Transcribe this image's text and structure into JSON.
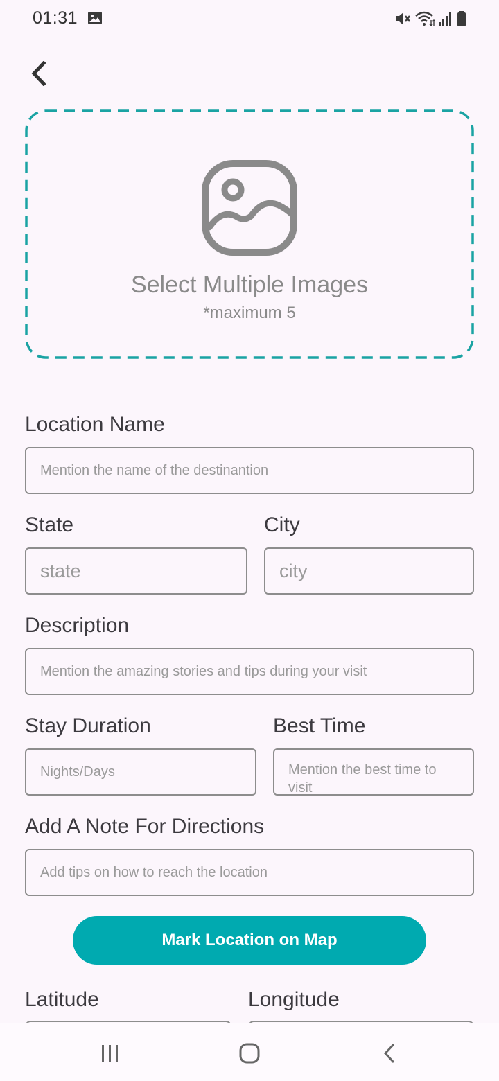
{
  "status_bar": {
    "time": "01:31",
    "icons": [
      "gallery-icon",
      "mute-icon",
      "wifi-icon",
      "signal-icon",
      "battery-icon"
    ]
  },
  "navigation": {
    "back_icon": "chevron-left-icon"
  },
  "image_picker": {
    "icon": "image-icon",
    "title": "Select Multiple Images",
    "subtitle": "*maximum 5",
    "accent_color": "#1aa3a3"
  },
  "form": {
    "location_name": {
      "label": "Location Name",
      "placeholder": "Mention the name of the destinantion"
    },
    "state": {
      "label": "State",
      "placeholder": "state"
    },
    "city": {
      "label": "City",
      "placeholder": "city"
    },
    "description": {
      "label": "Description",
      "placeholder": "Mention the amazing stories and tips during your visit"
    },
    "stay_duration": {
      "label": "Stay Duration",
      "placeholder": "Nights/Days"
    },
    "best_time": {
      "label": "Best Time",
      "placeholder": "Mention the best time to visit"
    },
    "directions_note": {
      "label": "Add A Note For Directions",
      "placeholder": "Add tips on how to reach the location"
    },
    "map_button": {
      "label": "Mark Location on Map",
      "color": "#00aab0"
    },
    "latitude": {
      "label": "Latitude"
    },
    "longitude": {
      "label": "Longitude"
    }
  },
  "system_nav": {
    "icons": [
      "recent-apps-icon",
      "home-icon",
      "back-icon"
    ]
  }
}
